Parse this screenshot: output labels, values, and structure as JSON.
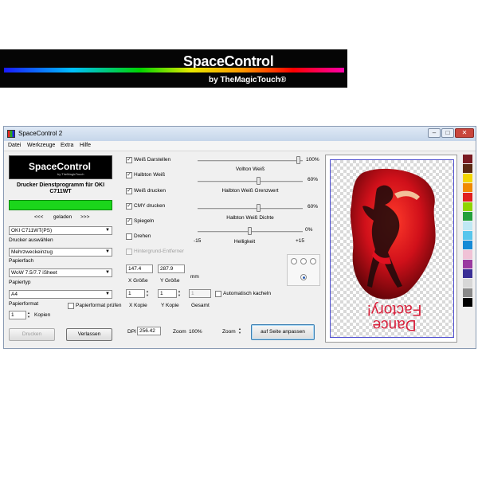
{
  "banner": {
    "title": "SpaceControl",
    "subtitle": "by TheMagicTouch®"
  },
  "window": {
    "title": "SpaceControl 2"
  },
  "menu": [
    "Datei",
    "Werkzeuge",
    "Extra",
    "Hilfe"
  ],
  "logo": {
    "title": "SpaceControl",
    "subtitle": "by TheMagicTouch"
  },
  "printer": {
    "label": "Drucker Dienstprogramm für   OKI C711WT",
    "nav_prev": "<<<",
    "status": "geladen",
    "nav_next": ">>>"
  },
  "left": {
    "printer_select": "OKI C711WT(PS)",
    "printer_select_label": "Drucker auswählen",
    "tray_value": "Mehrzweckeinzug",
    "tray_label": "Papierfach",
    "paper_type_value": "WoW 7.5/7.7 iSheet",
    "paper_type_label": "Papiertyp",
    "format_value": "A4",
    "format_label": "Papierformat",
    "check_format_label": "Papierformat prüfen",
    "copies_value": "1",
    "copies_label": "Kopien",
    "print_button": "Drucken",
    "quit_button": "Verlassen"
  },
  "options": {
    "white_show": "Weiß Darstellen",
    "halftone_white": "Halbton Weiß",
    "white_print": "Weiß drucken",
    "cmy_print": "CMY drucken",
    "mirror": "Spiegeln",
    "rotate": "Drehen",
    "bg_remover": "Hintergrund-Entferner"
  },
  "sliders": {
    "full_white_value": "100%",
    "full_white_label": "Vollton Weiß",
    "halftone_limit_value": "60%",
    "halftone_limit_label": "Halbton Weiß Grenzwert",
    "halftone_density_value": "60%",
    "halftone_density_label": "Halbton Weiß Dichte",
    "brightness_value": "0%",
    "brightness_min": "-15",
    "brightness_label": "Helligkeit",
    "brightness_max": "+15"
  },
  "sizes": {
    "x_size": "147.4",
    "y_size": "287.9",
    "unit": "mm",
    "x_size_label": "X Größe",
    "y_size_label": "Y Größe",
    "x_copies": "1",
    "y_copies": "1",
    "total": "1",
    "auto_tile": "Automatisch kacheln",
    "x_copies_label": "X Kopie",
    "y_copies_label": "Y Kopie",
    "total_label": "Gesamt"
  },
  "footer": {
    "dpi_label": "DPI",
    "dpi_value": "256.42",
    "zoom_label": "Zoom",
    "zoom_value": "100%",
    "zoom2_label": "Zoom",
    "fit_button": "auf Seite anpassen"
  },
  "preview": {
    "text_line1": "Dance",
    "text_line2": "Factory!"
  },
  "colors": {
    "palette": [
      "#7a1b22",
      "#5a2a14",
      "#f2d600",
      "#f08a00",
      "#e02020",
      "#8fd400",
      "#23a03c",
      "#bfe8f4",
      "#58c6ec",
      "#168ad6",
      "#f0c2d6",
      "#9a3aa0",
      "#3a2f96",
      "#d7d7d7",
      "#8a8a8a",
      "#000000"
    ],
    "status_green": "#1bd61b",
    "accent": "#d81f3a"
  }
}
